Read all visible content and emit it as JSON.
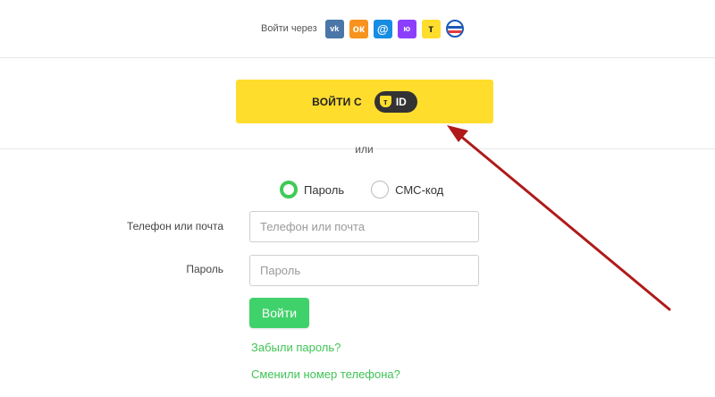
{
  "social": {
    "label": "Войти через",
    "icons": [
      {
        "name": "vk-icon",
        "glyph": "vk"
      },
      {
        "name": "odnoklassniki-icon",
        "glyph": "ок"
      },
      {
        "name": "mail-ru-icon",
        "glyph": "@"
      },
      {
        "name": "yoomoney-icon",
        "glyph": "ю"
      },
      {
        "name": "tbank-icon",
        "glyph": "т"
      },
      {
        "name": "gosuslugi-icon",
        "glyph": ""
      }
    ]
  },
  "tid": {
    "label": "ВОЙТИ С",
    "badge_shield": "т",
    "badge_text": "ID"
  },
  "or_text": "или",
  "auth_method": {
    "options": [
      "Пароль",
      "СМС-код"
    ],
    "selected": "Пароль"
  },
  "form": {
    "login_label": "Телефон или почта",
    "login_placeholder": "Телефон или почта",
    "password_label": "Пароль",
    "password_placeholder": "Пароль",
    "submit_label": "Войти"
  },
  "links": {
    "forgot_password": "Забыли пароль?",
    "changed_phone": "Сменили номер телефона?"
  },
  "colors": {
    "accent_green": "#40d26a",
    "tid_yellow": "#ffdd2d",
    "annotation_arrow": "#b01a1a"
  }
}
